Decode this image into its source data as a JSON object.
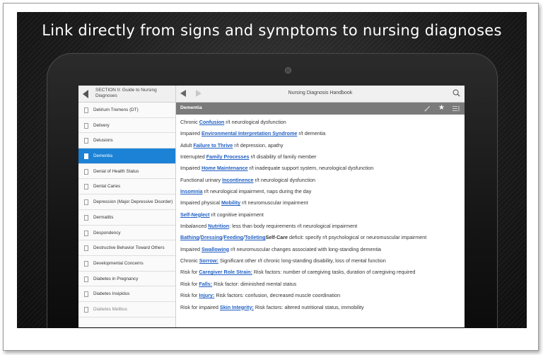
{
  "headline": "Link directly from signs and symptoms to nursing diagnoses",
  "left_panel": {
    "header_title": "SECTION II: Guide to Nursing Diagnoses",
    "items": [
      {
        "label": "Delirium Tremens (DT)",
        "selected": false
      },
      {
        "label": "Delivery",
        "selected": false
      },
      {
        "label": "Delusions",
        "selected": false
      },
      {
        "label": "Dementia",
        "selected": true
      },
      {
        "label": "Denial of Health Status",
        "selected": false
      },
      {
        "label": "Dental Caries",
        "selected": false
      },
      {
        "label": "Depression (Major Depressive Disorder)",
        "selected": false
      },
      {
        "label": "Dermatitis",
        "selected": false
      },
      {
        "label": "Despondency",
        "selected": false
      },
      {
        "label": "Destructive Behavior Toward Others",
        "selected": false
      },
      {
        "label": "Developmental Concerns",
        "selected": false
      },
      {
        "label": "Diabetes in Pregnancy",
        "selected": false
      },
      {
        "label": "Diabetes Insipidus",
        "selected": false
      },
      {
        "label": "Diabetes Mellitus",
        "selected": false
      }
    ]
  },
  "toolbar": {
    "title": "Nursing Diagnosis Handbook",
    "back_icon": "arrow-left-icon",
    "forward_icon": "arrow-right-icon",
    "search_icon": "search-icon"
  },
  "section": {
    "title": "Dementia",
    "icons": [
      "pencil-icon",
      "star-icon",
      "list-icon"
    ]
  },
  "entries": [
    [
      {
        "t": "Chronic "
      },
      {
        "t": "Confusion",
        "link": true
      },
      {
        "t": " r/t neurological dysfunction"
      }
    ],
    [
      {
        "t": "Impaired "
      },
      {
        "t": "Environmental Interpretation Syndrome",
        "link": true
      },
      {
        "t": " r/t dementia"
      }
    ],
    [
      {
        "t": "Adult "
      },
      {
        "t": "Failure to Thrive",
        "link": true
      },
      {
        "t": " r/t depression, apathy"
      }
    ],
    [
      {
        "t": "Interrupted "
      },
      {
        "t": "Family Processes",
        "link": true
      },
      {
        "t": " r/t disability of family member"
      }
    ],
    [
      {
        "t": "Impaired "
      },
      {
        "t": "Home Maintenance",
        "link": true
      },
      {
        "t": " r/t inadequate support system, neurological dysfunction"
      }
    ],
    [
      {
        "t": "Functional urinary "
      },
      {
        "t": "Incontinence",
        "link": true
      },
      {
        "t": " r/t neurological dysfunction"
      }
    ],
    [
      {
        "t": "Insomnia",
        "link": true
      },
      {
        "t": " r/t neurological impairment, naps during the day"
      }
    ],
    [
      {
        "t": "Impaired physical "
      },
      {
        "t": "Mobility",
        "link": true
      },
      {
        "t": " r/t neuromuscular impairment"
      }
    ],
    [
      {
        "t": "Self-Neglect",
        "link": true
      },
      {
        "t": " r/t cognitive impairment"
      }
    ],
    [
      {
        "t": "Imbalanced "
      },
      {
        "t": "Nutrition",
        "link": true
      },
      {
        "t": ": less than body requirements r/t neurological impairment"
      }
    ],
    [
      {
        "t": "Bathing",
        "link": true
      },
      {
        "t": "/"
      },
      {
        "t": "Dressing",
        "link": true
      },
      {
        "t": "/"
      },
      {
        "t": "Feeding",
        "link": true
      },
      {
        "t": "/"
      },
      {
        "t": "Toileting",
        "link": true
      },
      {
        "t": "Self-Care",
        "bold": true
      },
      {
        "t": " deficit: specify r/t psychological or neuromuscular impairment"
      }
    ],
    [
      {
        "t": "Impaired "
      },
      {
        "t": "Swallowing",
        "link": true
      },
      {
        "t": " r/t neuromuscular changes associated with long-standing dementia"
      }
    ],
    [
      {
        "t": "Chronic "
      },
      {
        "t": "Sorrow:",
        "link": true
      },
      {
        "t": " Significant other r/t chronic long-standing disability, loss of mental function"
      }
    ],
    [
      {
        "t": "Risk for "
      },
      {
        "t": "Caregiver Role Strain:",
        "link": true
      },
      {
        "t": " Risk factors: number of caregiving tasks, duration of caregiving required"
      }
    ],
    [
      {
        "t": "Risk for "
      },
      {
        "t": "Falls:",
        "link": true
      },
      {
        "t": " Risk factor: diminished mental status"
      }
    ],
    [
      {
        "t": "Risk for "
      },
      {
        "t": "Injury:",
        "link": true
      },
      {
        "t": " Risk factors: confusion, decreased muscle coordination"
      }
    ],
    [
      {
        "t": "Risk for impaired "
      },
      {
        "t": "Skin Integrity:",
        "link": true
      },
      {
        "t": " Risk factors: altered nutritional status, immobility"
      }
    ]
  ],
  "system_nav": {
    "icons": [
      "back-nav-icon",
      "home-nav-icon",
      "recents-nav-icon",
      "overflow-menu-icon"
    ]
  },
  "colors": {
    "selection": "#1b82d6",
    "link": "#1f5fc4",
    "section_bar": "#7a7a7a"
  }
}
